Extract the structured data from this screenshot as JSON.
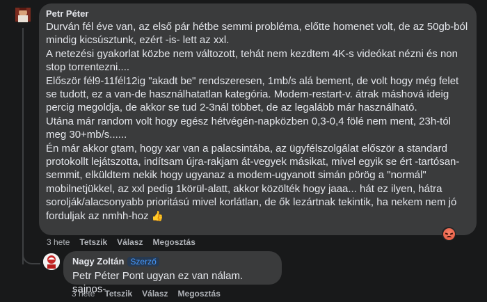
{
  "main_comment": {
    "author": "Petr Péter",
    "paragraphs": [
      "Durván fél éve van, az első pár hétbe semmi probléma, előtte homenet volt, de az 50gb-ból mindig kicsúsztunk, ezért -is- lett az xxl.",
      "A netezési gyakorlat közbe nem változott, tehát nem kezdtem 4K-s videókat nézni és non stop torrentezni....",
      "Először fél9-11fél12ig \"akadt be\" rendszeresen, 1mb/s alá bement, de volt hogy még felet se tudott, ez a van-de használhatatlan kategória. Modem-restart-v. átrak máshová ideig percig megoldja, de akkor se tud 2-3nál többet, de az legalább már használható.",
      "Utána már random volt hogy egész hétvégén-napközben 0,3-0,4 fölé nem ment, 23h-tól meg 30+mb/s......",
      "Én már akkor gtam, hogy xar van a palacsintába, az ügyfélszolgálat először a standard protokollt lejátszotta, indítsam újra-rakjam át-vegyek másikat, mivel egyik se ért -tartósan- semmit, elküldtem nekik hogy ugyanaz a modem-ugyanott simán pörög a \"normál\" mobilnetjükkel, az xxl pedig 1körül-alatt, akkor közölték hogy jaaa... hát ez ilyen, hátra sorolják/alacsonyabb prioritású mivel korlátlan, de ők lezártnak tekintik, ha nekem nem jó forduljak az nmhh-hoz"
    ],
    "thumb_emoji": "👍",
    "reaction_icon": "angry-reaction-icon",
    "time": "3 hete",
    "like_label": "Tetszik",
    "reply_label": "Válasz",
    "share_label": "Megosztás"
  },
  "reply_comment": {
    "author": "Nagy Zoltán",
    "badge": "Szerző",
    "mention": "Petr Péter",
    "text": " Pont ugyan ez van nálam. sajnos-",
    "time": "3 hete",
    "like_label": "Tetszik",
    "reply_label": "Válasz",
    "share_label": "Megosztás"
  },
  "colors": {
    "background": "#18191a",
    "bubble": "#3a3b3c",
    "text": "#e4e6eb",
    "secondary_text": "#b0b3b8",
    "badge_text": "#4599ff"
  }
}
